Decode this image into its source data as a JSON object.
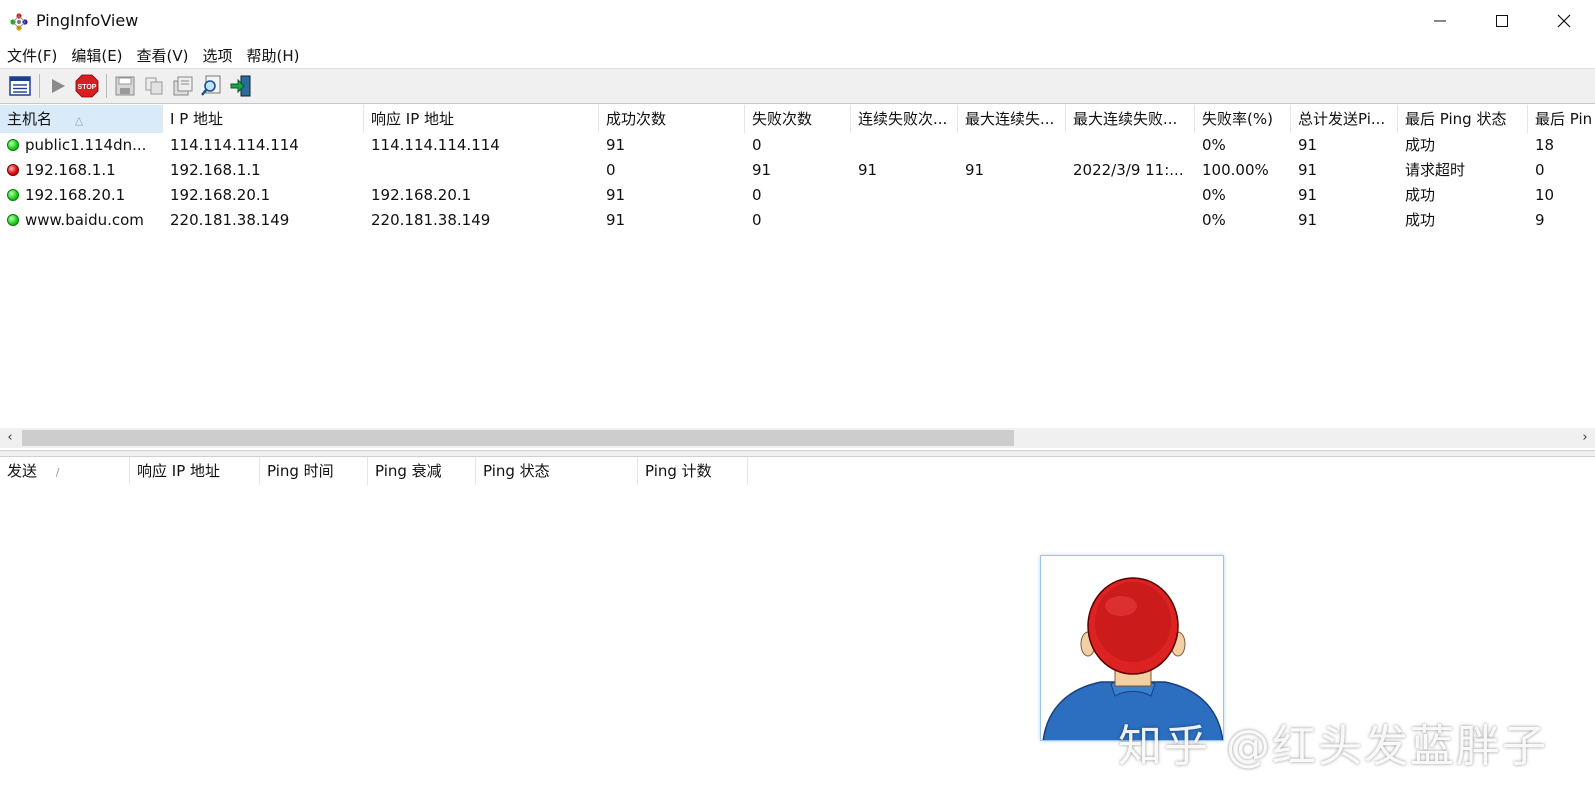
{
  "window": {
    "title": "PingInfoView"
  },
  "menu": [
    "文件(F)",
    "编辑(E)",
    "查看(V)",
    "选项",
    "帮助(H)"
  ],
  "toolbar": {
    "buttons": [
      "properties-icon",
      "start-icon",
      "stop-icon",
      "save-icon",
      "copy-icon",
      "html-report-icon",
      "find-icon",
      "exit-icon"
    ],
    "stop_label": "STOP"
  },
  "top_grid": {
    "columns": [
      "主机名",
      "I P 地址",
      "响应 IP 地址",
      "成功次数",
      "失败次数",
      "连续失败次...",
      "最大连续失...",
      "最大连续失败...",
      "失败率(%)",
      "总计发送Pi...",
      "最后 Ping 状态",
      "最后 Pin"
    ],
    "sort_indicator": "△",
    "rows": [
      {
        "status": "ok",
        "cells": [
          "public1.114dn...",
          "114.114.114.114",
          "114.114.114.114",
          "91",
          "0",
          "",
          "",
          "",
          "0%",
          "91",
          "成功",
          "18"
        ]
      },
      {
        "status": "bad",
        "cells": [
          "192.168.1.1",
          "192.168.1.1",
          "",
          "0",
          "91",
          "91",
          "91",
          "2022/3/9 11:...",
          "100.00%",
          "91",
          "请求超时",
          "0"
        ]
      },
      {
        "status": "ok",
        "cells": [
          "192.168.20.1",
          "192.168.20.1",
          "192.168.20.1",
          "91",
          "0",
          "",
          "",
          "",
          "0%",
          "91",
          "成功",
          "10"
        ]
      },
      {
        "status": "ok",
        "cells": [
          "www.baidu.com",
          "220.181.38.149",
          "220.181.38.149",
          "91",
          "0",
          "",
          "",
          "",
          "0%",
          "91",
          "成功",
          "9"
        ]
      }
    ]
  },
  "scroll": {
    "left": "‹",
    "right": "›"
  },
  "bottom_grid": {
    "columns": [
      "发送",
      "响应 IP 地址",
      "Ping 时间",
      "Ping 衰减",
      "Ping 状态",
      "Ping 计数"
    ],
    "sort_indicator": "/"
  },
  "watermark": "知乎 @红头发蓝胖子",
  "colors": {
    "ok": "#1fd11f",
    "bad": "#e01010",
    "selected_header": "#d9ebf9"
  }
}
